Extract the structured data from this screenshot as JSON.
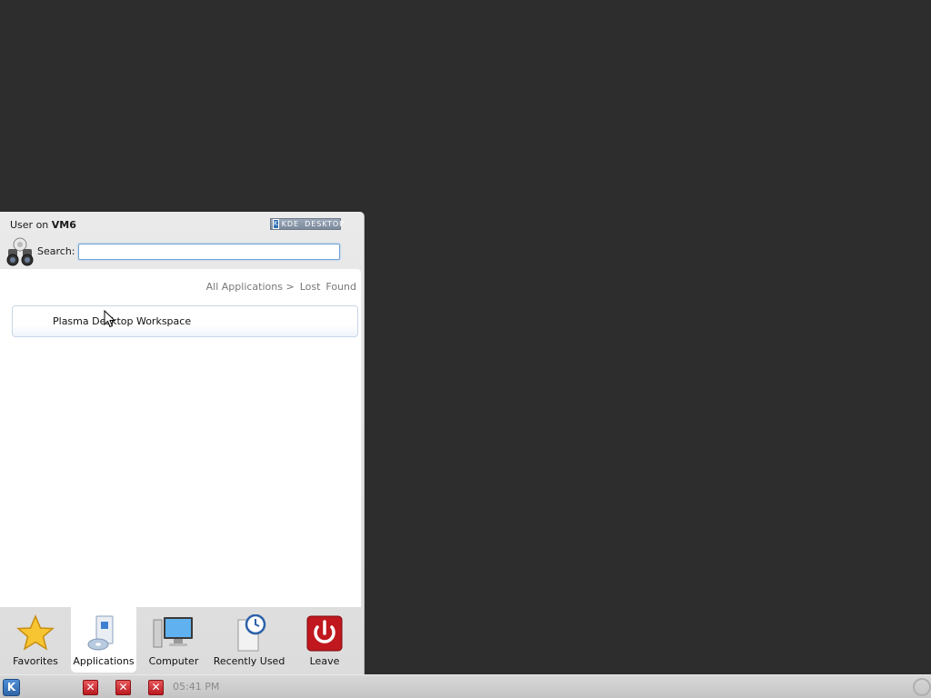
{
  "launcher": {
    "user_prefix": "User on",
    "host": "VM6",
    "badge_k": "K",
    "badge_kde": "KDE",
    "badge_desktop": "DESKTOP",
    "search_label": "Search:",
    "search_value": "",
    "breadcrumb": [
      "All Applications >",
      "Lost",
      "Found"
    ],
    "app_items": [
      {
        "name": "Plasma Desktop Workspace"
      }
    ],
    "tabs": [
      {
        "label": "Favorites",
        "icon": "star-icon"
      },
      {
        "label": "Applications",
        "icon": "applications-icon",
        "active": true
      },
      {
        "label": "Computer",
        "icon": "computer-icon"
      },
      {
        "label": "Recently Used",
        "icon": "recently-used-icon"
      },
      {
        "label": "Leave",
        "icon": "power-icon"
      }
    ]
  },
  "taskbar": {
    "kmenu_glyph": "K",
    "task_glyph": "✕",
    "clock": "05:41 PM"
  },
  "colors": {
    "desktop_bg": "#2d2d2d",
    "accent_blue": "#2e64a8",
    "leave_red": "#c0181e"
  }
}
